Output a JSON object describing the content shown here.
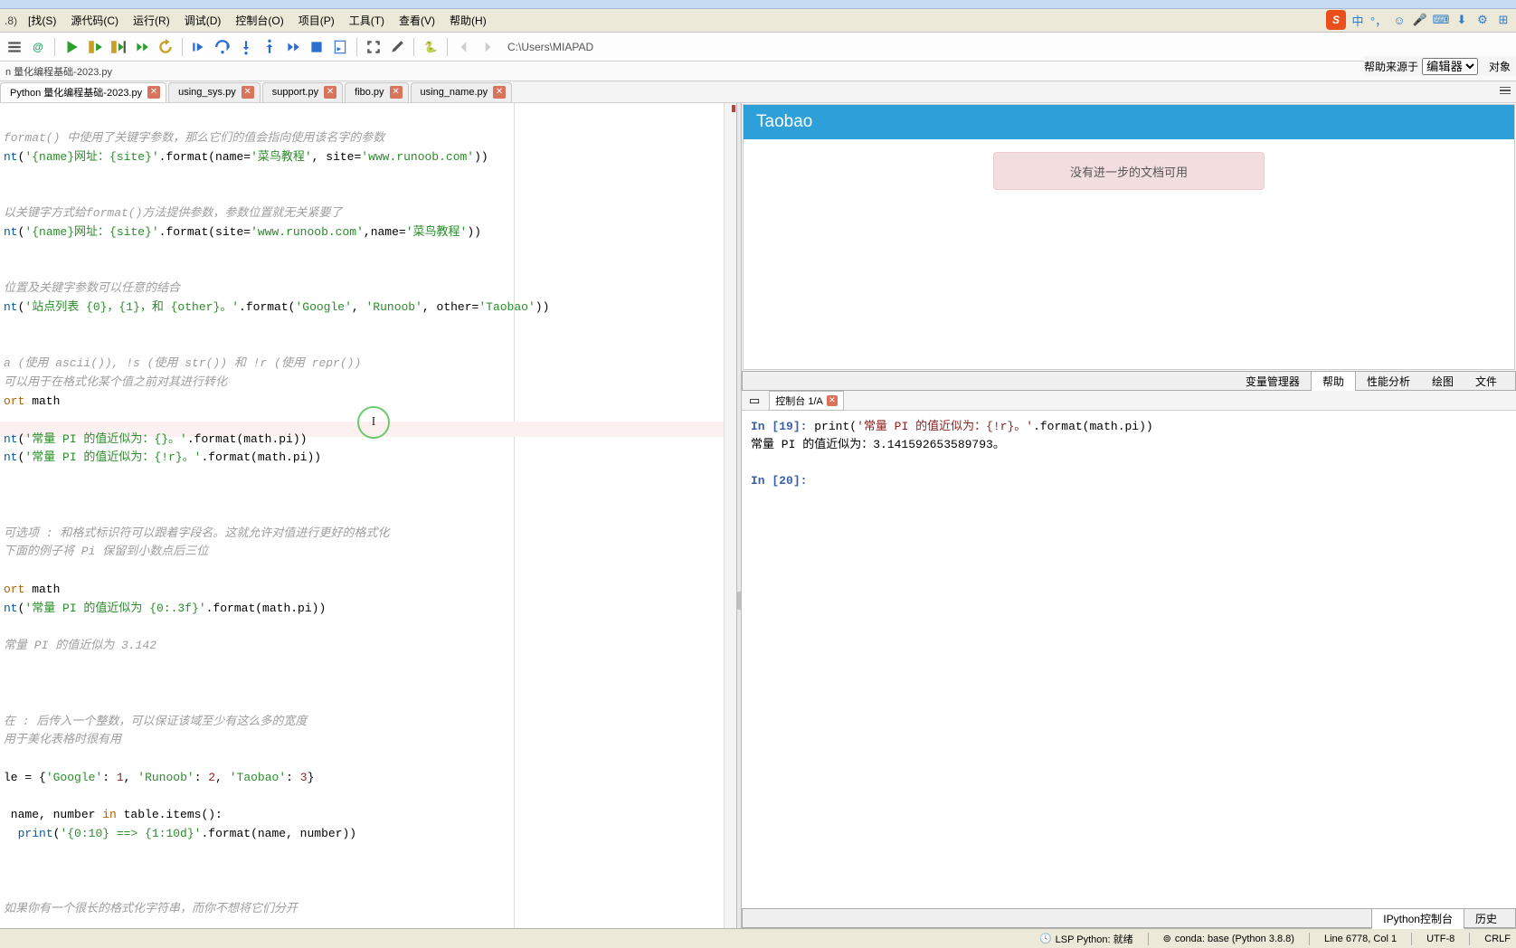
{
  "partial_title": ".8)",
  "menubar": {
    "items": [
      "[找(S)",
      "源代码(C)",
      "运行(R)",
      "调试(D)",
      "控制台(O)",
      "项目(P)",
      "工具(T)",
      "查看(V)",
      "帮助(H)"
    ]
  },
  "input_icons": [
    "sogou",
    "中",
    "punct",
    "smile",
    "mic",
    "pad",
    "下",
    "gear",
    "grid"
  ],
  "toolbar_path": "C:\\Users\\MIAPAD",
  "breadcrumb": "n 量化编程基础-2023.py",
  "tabs": [
    {
      "label": "Python 量化编程基础-2023.py",
      "active": true
    },
    {
      "label": "using_sys.py",
      "active": false
    },
    {
      "label": "support.py",
      "active": false
    },
    {
      "label": "fibo.py",
      "active": false
    },
    {
      "label": "using_name.py",
      "active": false
    }
  ],
  "code_lines": [
    {
      "cls": "c-comment",
      "text": "format() 中使用了关键字参数，那么它们的值会指向使用该名字的参数"
    },
    {
      "mixed": true,
      "parts": [
        {
          "cls": "c-fn",
          "text": "nt"
        },
        {
          "cls": "",
          "text": "("
        },
        {
          "cls": "c-str",
          "text": "'{name}网址：{site}'"
        },
        {
          "cls": "",
          "text": ".format(name="
        },
        {
          "cls": "c-str",
          "text": "'菜鸟教程'"
        },
        {
          "cls": "",
          "text": ", site="
        },
        {
          "cls": "c-str",
          "text": "'www.runoob.com'"
        },
        {
          "cls": "",
          "text": "))"
        }
      ]
    },
    {
      "blank": true
    },
    {
      "blank": true
    },
    {
      "cls": "c-comment",
      "text": "以关键字方式给format()方法提供参数，参数位置就无关紧要了"
    },
    {
      "mixed": true,
      "parts": [
        {
          "cls": "c-fn",
          "text": "nt"
        },
        {
          "cls": "",
          "text": "("
        },
        {
          "cls": "c-str",
          "text": "'{name}网址：{site}'"
        },
        {
          "cls": "",
          "text": ".format(site="
        },
        {
          "cls": "c-str",
          "text": "'www.runoob.com'"
        },
        {
          "cls": "",
          "text": ",name="
        },
        {
          "cls": "c-str",
          "text": "'菜鸟教程'"
        },
        {
          "cls": "",
          "text": "))"
        }
      ]
    },
    {
      "blank": true
    },
    {
      "blank": true
    },
    {
      "cls": "c-comment",
      "text": "位置及关键字参数可以任意的结合"
    },
    {
      "mixed": true,
      "parts": [
        {
          "cls": "c-fn",
          "text": "nt"
        },
        {
          "cls": "",
          "text": "("
        },
        {
          "cls": "c-str",
          "text": "'站点列表 {0}，{1}，和 {other}。'"
        },
        {
          "cls": "",
          "text": ".format("
        },
        {
          "cls": "c-str",
          "text": "'Google'"
        },
        {
          "cls": "",
          "text": ", "
        },
        {
          "cls": "c-str",
          "text": "'Runoob'"
        },
        {
          "cls": "",
          "text": ", other="
        },
        {
          "cls": "c-str",
          "text": "'Taobao'"
        },
        {
          "cls": "",
          "text": "))"
        }
      ]
    },
    {
      "blank": true
    },
    {
      "blank": true
    },
    {
      "cls": "c-comment",
      "text": "a (使用 ascii()), !s (使用 str()) 和 !r (使用 repr())"
    },
    {
      "cls": "c-comment",
      "text": "可以用于在格式化某个值之前对其进行转化"
    },
    {
      "mixed": true,
      "parts": [
        {
          "cls": "c-kw",
          "text": "ort"
        },
        {
          "cls": "",
          "text": " math"
        }
      ]
    },
    {
      "blank": true
    },
    {
      "mixed": true,
      "parts": [
        {
          "cls": "c-fn",
          "text": "nt"
        },
        {
          "cls": "",
          "text": "("
        },
        {
          "cls": "c-str",
          "text": "'常量 PI 的值近似为：{}。'"
        },
        {
          "cls": "",
          "text": ".format(math.pi))"
        }
      ]
    },
    {
      "mixed": true,
      "parts": [
        {
          "cls": "c-fn",
          "text": "nt"
        },
        {
          "cls": "",
          "text": "("
        },
        {
          "cls": "c-str",
          "text": "'常量 PI 的值近似为：{!r}。'"
        },
        {
          "cls": "",
          "text": ".format(math.pi))"
        }
      ]
    },
    {
      "blank": true
    },
    {
      "blank": true
    },
    {
      "blank": true
    },
    {
      "cls": "c-comment",
      "text": "可选项 : 和格式标识符可以跟着字段名。这就允许对值进行更好的格式化"
    },
    {
      "cls": "c-comment",
      "text": "下面的例子将 Pi 保留到小数点后三位"
    },
    {
      "blank": true
    },
    {
      "mixed": true,
      "parts": [
        {
          "cls": "c-kw",
          "text": "ort"
        },
        {
          "cls": "",
          "text": " math"
        }
      ]
    },
    {
      "mixed": true,
      "parts": [
        {
          "cls": "c-fn",
          "text": "nt"
        },
        {
          "cls": "",
          "text": "("
        },
        {
          "cls": "c-str",
          "text": "'常量 PI 的值近似为 {0:.3f}'"
        },
        {
          "cls": "",
          "text": ".format(math.pi))"
        }
      ]
    },
    {
      "blank": true
    },
    {
      "cls": "c-comment",
      "text": "常量 PI 的值近似为 3.142"
    },
    {
      "blank": true
    },
    {
      "blank": true
    },
    {
      "blank": true
    },
    {
      "cls": "c-comment",
      "text": "在 : 后传入一个整数，可以保证该域至少有这么多的宽度"
    },
    {
      "cls": "c-comment",
      "text": "用于美化表格时很有用"
    },
    {
      "blank": true
    },
    {
      "mixed": true,
      "parts": [
        {
          "cls": "",
          "text": "le = {"
        },
        {
          "cls": "c-str",
          "text": "'Google'"
        },
        {
          "cls": "",
          "text": ": "
        },
        {
          "cls": "c-num",
          "text": "1"
        },
        {
          "cls": "",
          "text": ", "
        },
        {
          "cls": "c-str",
          "text": "'Runoob'"
        },
        {
          "cls": "",
          "text": ": "
        },
        {
          "cls": "c-num",
          "text": "2"
        },
        {
          "cls": "",
          "text": ", "
        },
        {
          "cls": "c-str",
          "text": "'Taobao'"
        },
        {
          "cls": "",
          "text": ": "
        },
        {
          "cls": "c-num",
          "text": "3"
        },
        {
          "cls": "",
          "text": "}"
        }
      ]
    },
    {
      "blank": true
    },
    {
      "mixed": true,
      "parts": [
        {
          "cls": "",
          "text": " name, number "
        },
        {
          "cls": "c-kw",
          "text": "in"
        },
        {
          "cls": "",
          "text": " table.items():"
        }
      ]
    },
    {
      "mixed": true,
      "parts": [
        {
          "cls": "",
          "text": "  "
        },
        {
          "cls": "c-fn",
          "text": "print"
        },
        {
          "cls": "",
          "text": "("
        },
        {
          "cls": "c-str",
          "text": "'{0:10} ==> {1:10d}'"
        },
        {
          "cls": "",
          "text": ".format(name, number))"
        }
      ]
    },
    {
      "blank": true
    },
    {
      "blank": true
    },
    {
      "blank": true
    },
    {
      "cls": "c-comment",
      "text": "如果你有一个很长的格式化字符串，而你不想将它们分开"
    }
  ],
  "help": {
    "label": "帮助来源于",
    "source_options": [
      "编辑器"
    ],
    "object_label": "对象"
  },
  "doc": {
    "title": "Taobao",
    "alert": "没有进一步的文档可用"
  },
  "doc_tabs": [
    "变量管理器",
    "帮助",
    "性能分析",
    "绘图",
    "文件"
  ],
  "doc_tab_active": 1,
  "console_tab": "控制台 1/A",
  "console_lines": [
    {
      "type": "in",
      "num": "19",
      "code_parts": [
        {
          "cls": "",
          "text": "print("
        },
        {
          "cls": "pr-str",
          "text": "'常量 PI 的值近似为：{!r}。'"
        },
        {
          "cls": "",
          "text": ".format(math.pi))"
        }
      ]
    },
    {
      "type": "out",
      "text": "常量 PI 的值近似为：3.141592653589793。"
    },
    {
      "type": "blank"
    },
    {
      "type": "in-empty",
      "num": "20"
    }
  ],
  "bottom_tabs": [
    "IPython控制台",
    "历史"
  ],
  "bottom_tab_active": 0,
  "status": {
    "lsp": "LSP Python: 就绪",
    "conda": "conda: base (Python 3.8.8)",
    "line": "Line 6778, Col 1",
    "enc": "UTF-8",
    "eol": "CRLF"
  }
}
